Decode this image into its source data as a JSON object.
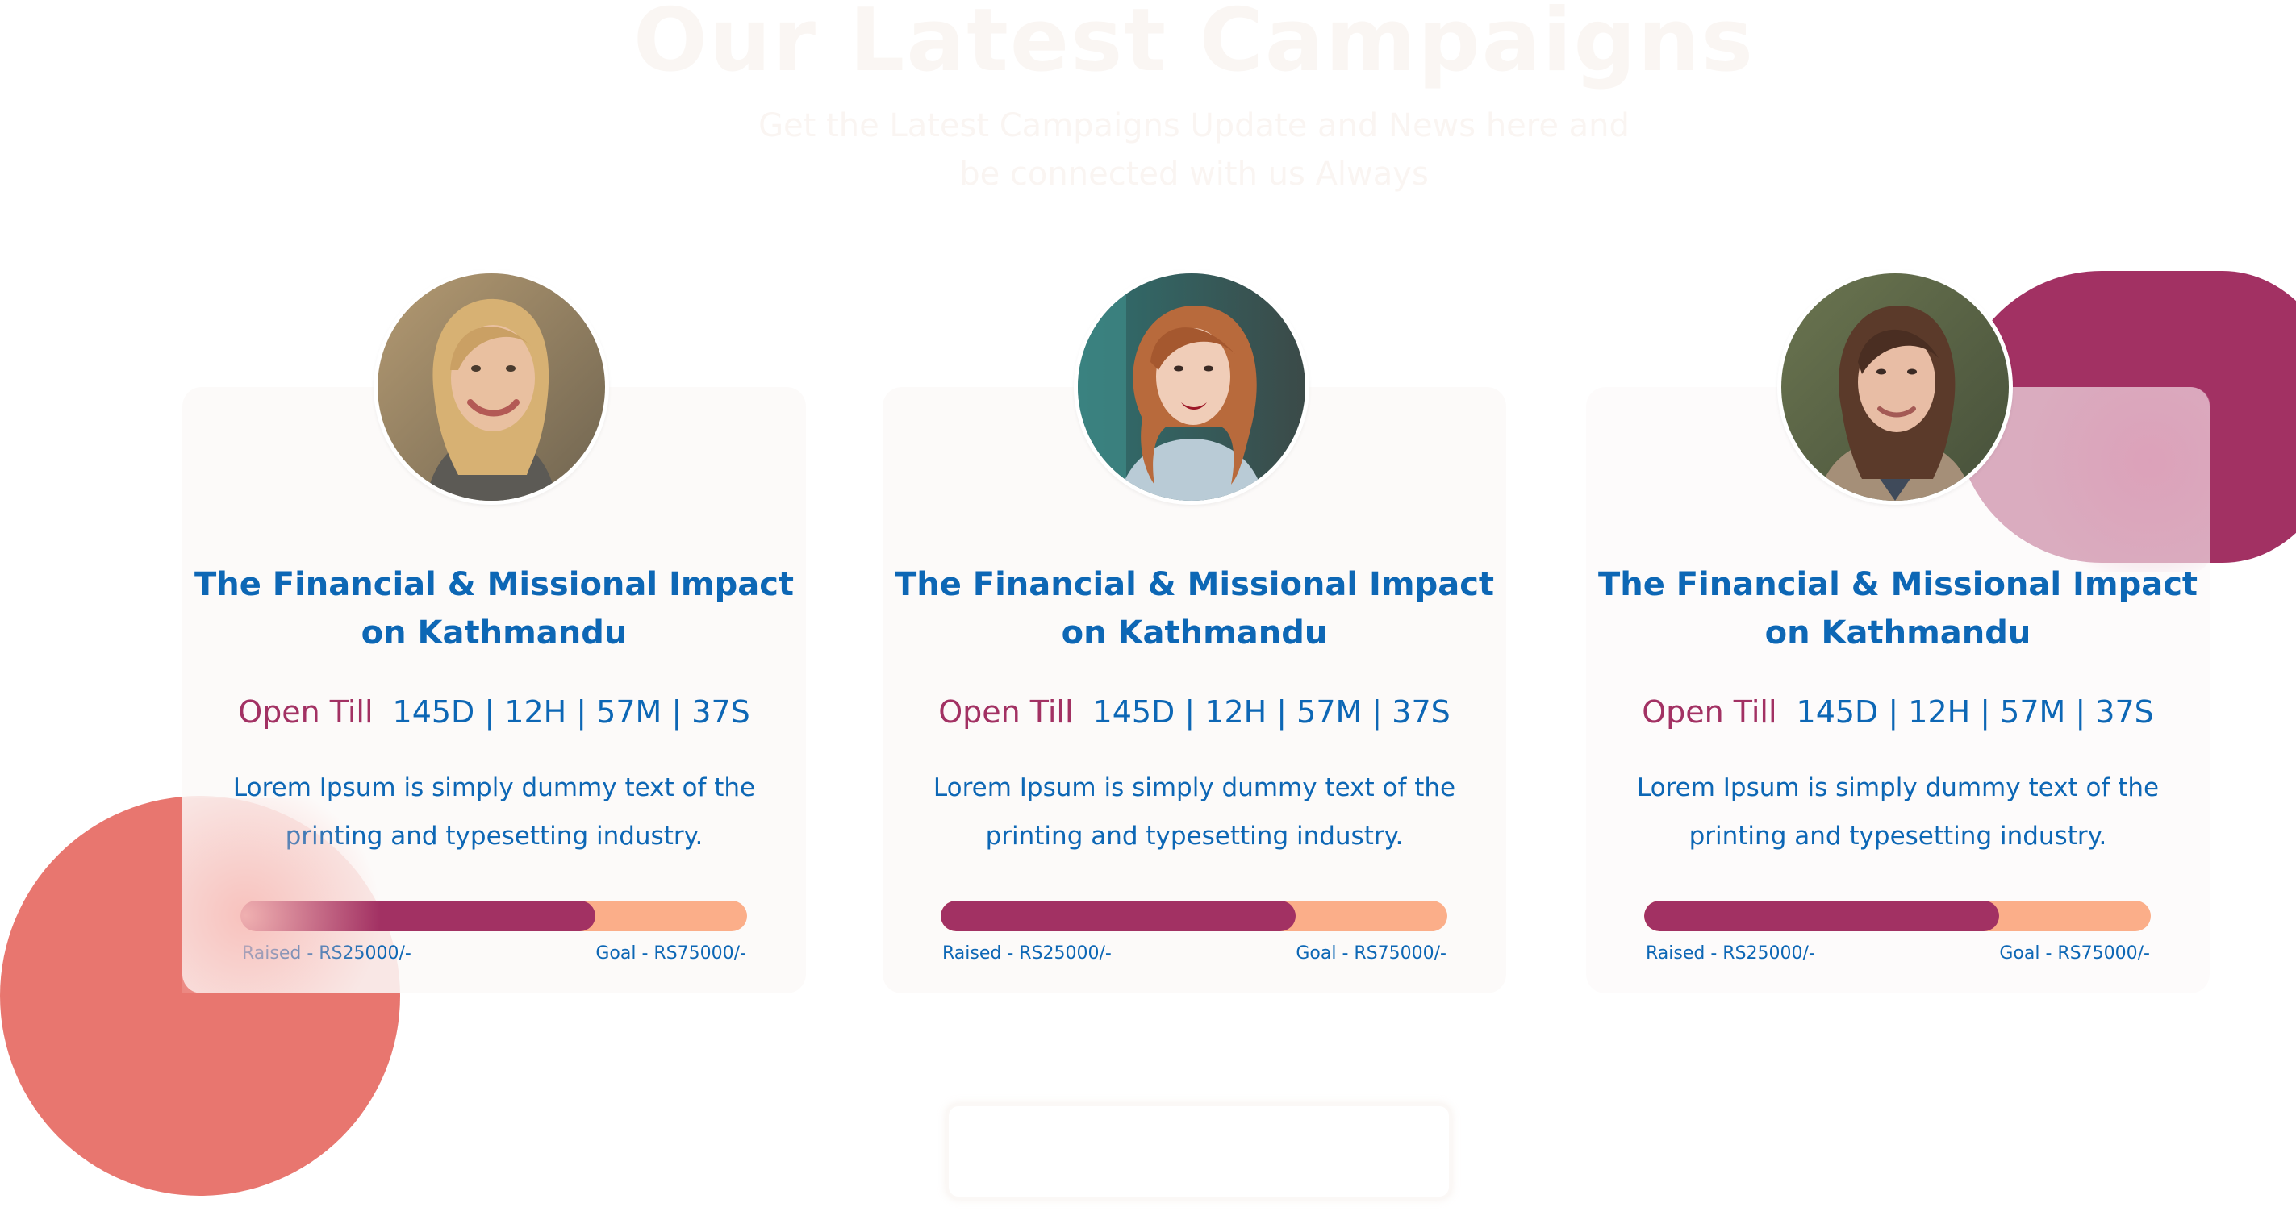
{
  "section": {
    "heading": "Our Latest Campaigns",
    "subheading": "Get the Latest Campaigns Update and News here and be connected with us Always"
  },
  "colors": {
    "accent": "#a23163",
    "primary_text": "#0d67b5",
    "progress_track": "#fbae89",
    "coral_blob": "#e8766f"
  },
  "campaigns": [
    {
      "avatar_icon": "avatar-photo",
      "title": "The Financial & Missional Impact on Kathmandu",
      "open_label": "Open Till",
      "countdown": "145D | 12H | 57M | 37S",
      "description": "Lorem Ipsum is simply dummy text of the printing and typesetting industry.",
      "progress": 0.7,
      "raised": "Raised - RS25000/-",
      "goal": "Goal - RS75000/-"
    },
    {
      "avatar_icon": "avatar-photo",
      "title": "The Financial & Missional Impact on Kathmandu",
      "open_label": "Open Till",
      "countdown": "145D | 12H | 57M | 37S",
      "description": "Lorem Ipsum is simply dummy text of the printing and typesetting industry.",
      "progress": 0.7,
      "raised": "Raised - RS25000/-",
      "goal": "Goal - RS75000/-"
    },
    {
      "avatar_icon": "avatar-photo",
      "title": "The Financial & Missional Impact on Kathmandu",
      "open_label": "Open Till",
      "countdown": "145D | 12H | 57M | 37S",
      "description": "Lorem Ipsum is simply dummy text of the printing and typesetting industry.",
      "progress": 0.7,
      "raised": "Raised - RS25000/-",
      "goal": "Goal - RS75000/-"
    }
  ]
}
